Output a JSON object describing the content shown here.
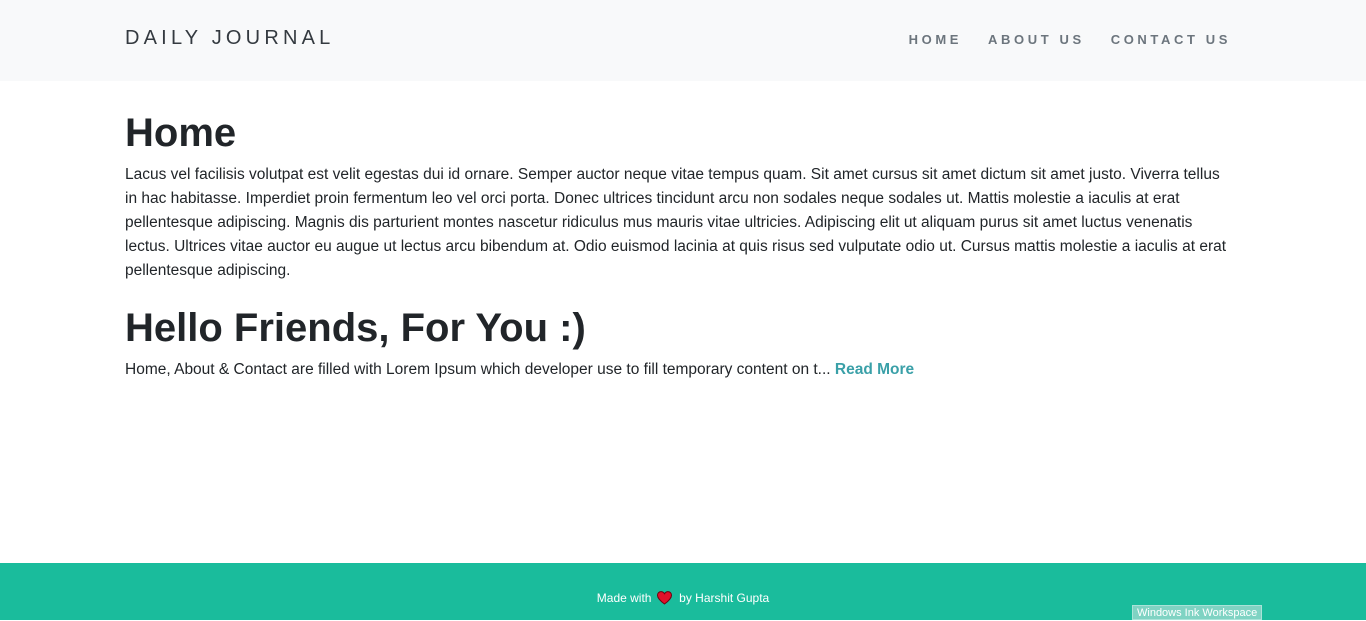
{
  "navbar": {
    "brand": "DAILY JOURNAL",
    "links": [
      "HOME",
      "ABOUT US",
      "CONTACT US"
    ]
  },
  "home": {
    "title": "Home",
    "body": "Lacus vel facilisis volutpat est velit egestas dui id ornare. Semper auctor neque vitae tempus quam. Sit amet cursus sit amet dictum sit amet justo. Viverra tellus in hac habitasse. Imperdiet proin fermentum leo vel orci porta. Donec ultrices tincidunt arcu non sodales neque sodales ut. Mattis molestie a iaculis at erat pellentesque adipiscing. Magnis dis parturient montes nascetur ridiculus mus mauris vitae ultricies. Adipiscing elit ut aliquam purus sit amet luctus venenatis lectus. Ultrices vitae auctor eu augue ut lectus arcu bibendum at. Odio euismod lacinia at quis risus sed vulputate odio ut. Cursus mattis molestie a iaculis at erat pellentesque adipiscing."
  },
  "post": {
    "title": "Hello Friends, For You :)",
    "snippet": "Home, About & Contact are filled with Lorem Ipsum which developer use to fill temporary content on t... ",
    "read_more": "Read More"
  },
  "footer": {
    "made_with": "Made with",
    "by": "by Harshit Gupta",
    "heart_icon": "heart-icon",
    "heart_color": "#e0102a"
  },
  "overlay": {
    "tooltip": "Windows Ink Workspace"
  },
  "colors": {
    "navbar_bg": "#f8f9fa",
    "footer_bg": "#1abc9c",
    "link_accent": "#3aa0a8"
  }
}
